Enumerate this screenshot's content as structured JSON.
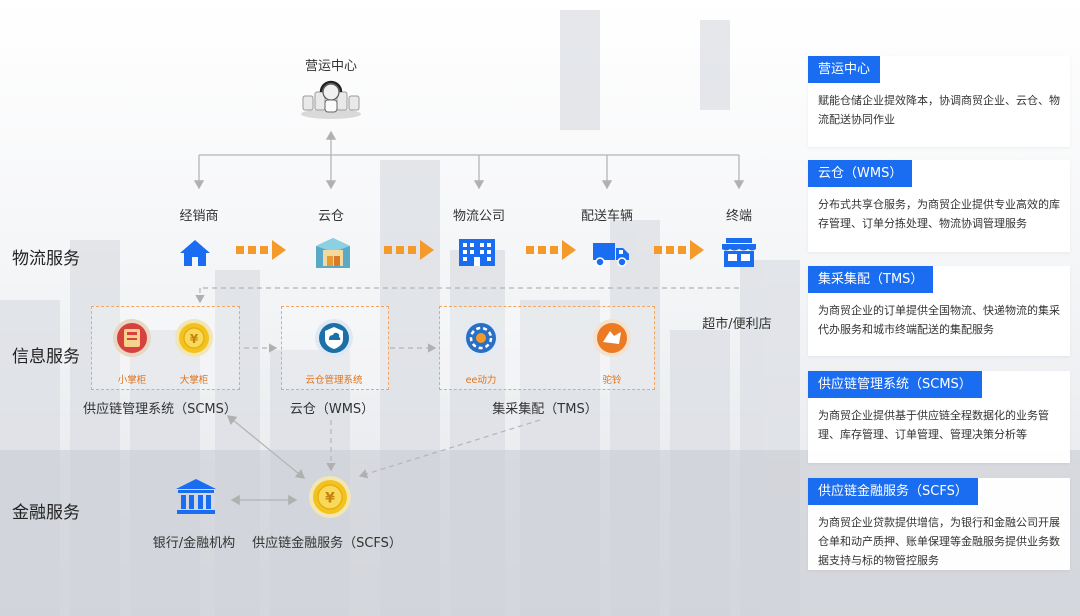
{
  "ops_center": {
    "label": "营运中心"
  },
  "logistics": {
    "row_label": "物流服务",
    "nodes": [
      "经销商",
      "云仓",
      "物流公司",
      "配送车辆",
      "终端"
    ],
    "terminal_sub": "超市/便利店"
  },
  "info": {
    "row_label": "信息服务",
    "scms": {
      "items": [
        "小掌柜",
        "大掌柜"
      ],
      "caption": "供应链管理系统（SCMS）"
    },
    "wms": {
      "items": [
        "云仓管理系统"
      ],
      "caption": "云仓（WMS）"
    },
    "tms": {
      "items": [
        "ee动力",
        "驼铃"
      ],
      "caption": "集采集配（TMS）"
    }
  },
  "finance": {
    "row_label": "金融服务",
    "bank_label": "银行/金融机构",
    "scfs_label": "供应链金融服务（SCFS）"
  },
  "panels": [
    {
      "title": "营运中心",
      "body": "赋能仓储企业提效降本，协调商贸企业、云仓、物流配送协同作业"
    },
    {
      "title": "云仓（WMS）",
      "body": "分布式共享仓服务，为商贸企业提供专业高效的库存管理、订单分拣处理、物流协调管理服务"
    },
    {
      "title": "集采集配（TMS）",
      "body": "为商贸企业的订单提供全国物流、快递物流的集采代办服务和城市终端配送的集配服务"
    },
    {
      "title": "供应链管理系统（SCMS）",
      "body": "为商贸企业提供基于供应链全程数据化的业务管理、库存管理、订单管理、管理决策分析等"
    },
    {
      "title": "供应链金融服务（SCFS）",
      "body": "为商贸企业贷款提供增信，为银行和金融公司开展仓单和动产质押、账单保理等金融服务提供业务数据支持与标的物管控服务"
    }
  ],
  "colors": {
    "blue": "#1a6df0",
    "orange": "#f39a2b",
    "gray_line": "#b5b5b5"
  },
  "icons": {
    "ops": "call-center-icon",
    "nodes": [
      "house-icon",
      "warehouse-icon",
      "office-building-icon",
      "delivery-truck-icon",
      "store-icon"
    ],
    "bank": "bank-building-icon"
  }
}
